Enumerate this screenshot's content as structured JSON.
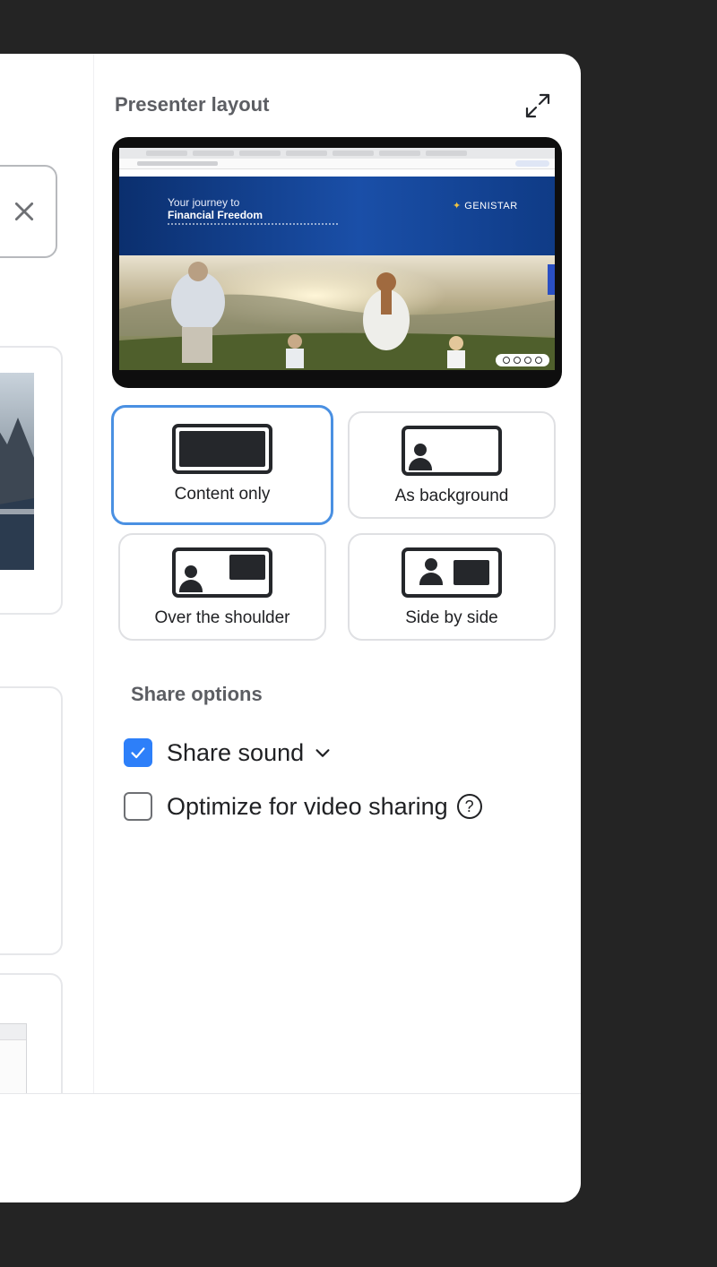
{
  "panel": {
    "title": "Presenter layout",
    "expand_icon": "expand-icon"
  },
  "preview": {
    "hero_line1": "Your journey to",
    "hero_line2": "Financial Freedom",
    "brand": "GENISTAR"
  },
  "layouts": [
    {
      "label": "Content only",
      "selected": true
    },
    {
      "label": "As background",
      "selected": false
    },
    {
      "label": "Over the shoulder",
      "selected": false
    },
    {
      "label": "Side by side",
      "selected": false
    }
  ],
  "share_options": {
    "title": "Share options",
    "share_sound": {
      "label": "Share sound",
      "checked": true
    },
    "optimize_video": {
      "label": "Optimize for video sharing",
      "checked": false
    },
    "help_glyph": "?"
  },
  "colors": {
    "accent": "#2d7ff9",
    "selected_border": "#4a90e2",
    "backdrop": "#242424"
  }
}
